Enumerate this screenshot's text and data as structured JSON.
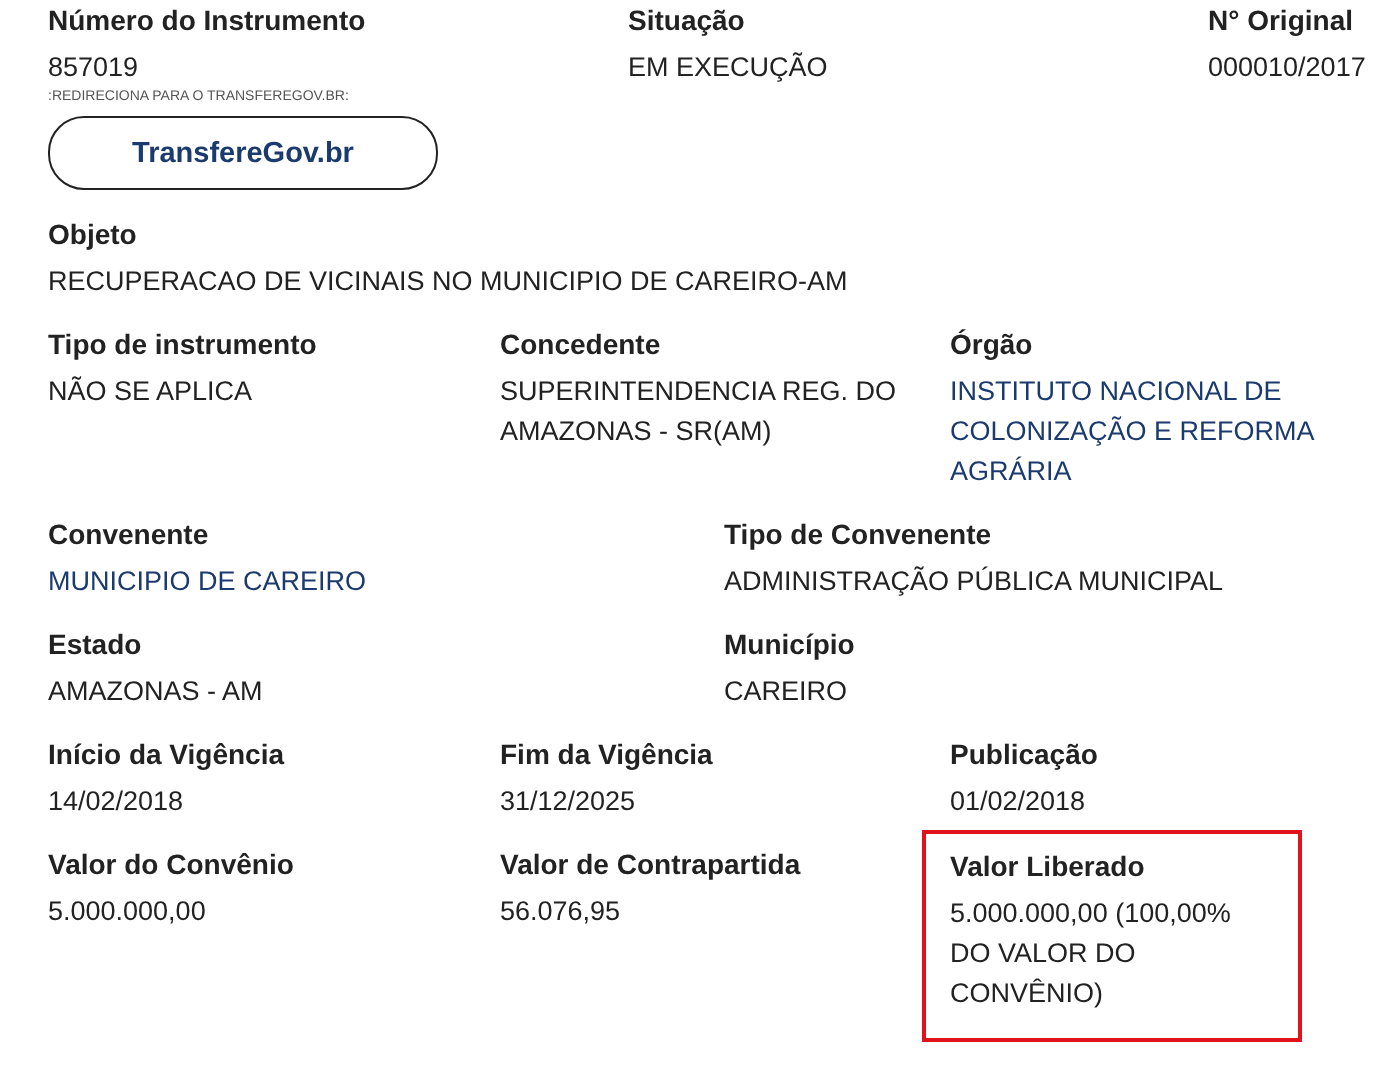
{
  "rows": [
    {
      "kind": "header",
      "fields": [
        {
          "label": "Número do Instrumento",
          "value": "857019",
          "link": false,
          "highlighted": false,
          "note": ":REDIRECIONA PARA O TRANSFEREGOV.BR:",
          "button": "TransfereGov.br"
        },
        {
          "label": "Situação",
          "value": "EM EXECUÇÃO",
          "link": false,
          "highlighted": false
        },
        {
          "label": "N° Original",
          "value": "000010/2017",
          "link": false,
          "highlighted": false
        }
      ]
    },
    {
      "kind": "full",
      "fields": [
        {
          "label": "Objeto",
          "value": "RECUPERACAO DE VICINAIS NO MUNICIPIO DE CAREIRO-AM",
          "link": false,
          "highlighted": false
        }
      ]
    },
    {
      "kind": "three",
      "fields": [
        {
          "label": "Tipo de instrumento",
          "value": "NÃO SE APLICA",
          "link": false,
          "highlighted": false
        },
        {
          "label": "Concedente",
          "value": "SUPERINTENDENCIA REG. DO AMAZONAS - SR(AM)",
          "link": false,
          "highlighted": false
        },
        {
          "label": "Órgão",
          "value": "INSTITUTO NACIONAL DE COLONIZAÇÃO E REFORMA AGRÁRIA",
          "link": true,
          "highlighted": false
        }
      ]
    },
    {
      "kind": "two",
      "fields": [
        {
          "label": "Convenente",
          "value": "MUNICIPIO DE CAREIRO",
          "link": true,
          "highlighted": false
        },
        {
          "label": "Tipo de Convenente",
          "value": "ADMINISTRAÇÃO PÚBLICA MUNICIPAL",
          "link": false,
          "highlighted": false
        }
      ]
    },
    {
      "kind": "two",
      "fields": [
        {
          "label": "Estado",
          "value": "AMAZONAS - AM",
          "link": false,
          "highlighted": false
        },
        {
          "label": "Município",
          "value": "CAREIRO",
          "link": false,
          "highlighted": false
        }
      ]
    },
    {
      "kind": "three",
      "fields": [
        {
          "label": "Início da Vigência",
          "value": "14/02/2018",
          "link": false,
          "highlighted": false
        },
        {
          "label": "Fim da Vigência",
          "value": "31/12/2025",
          "link": false,
          "highlighted": false
        },
        {
          "label": "Publicação",
          "value": "01/02/2018",
          "link": false,
          "highlighted": false
        }
      ]
    },
    {
      "kind": "three",
      "fields": [
        {
          "label": "Valor do Convênio",
          "value": "5.000.000,00",
          "link": false,
          "highlighted": false
        },
        {
          "label": "Valor de Contrapartida",
          "value": "56.076,95",
          "link": false,
          "highlighted": false
        },
        {
          "label": "Valor Liberado",
          "value": "5.000.000,00 (100,00% DO VALOR DO CONVÊNIO)",
          "link": false,
          "highlighted": true
        }
      ]
    }
  ]
}
